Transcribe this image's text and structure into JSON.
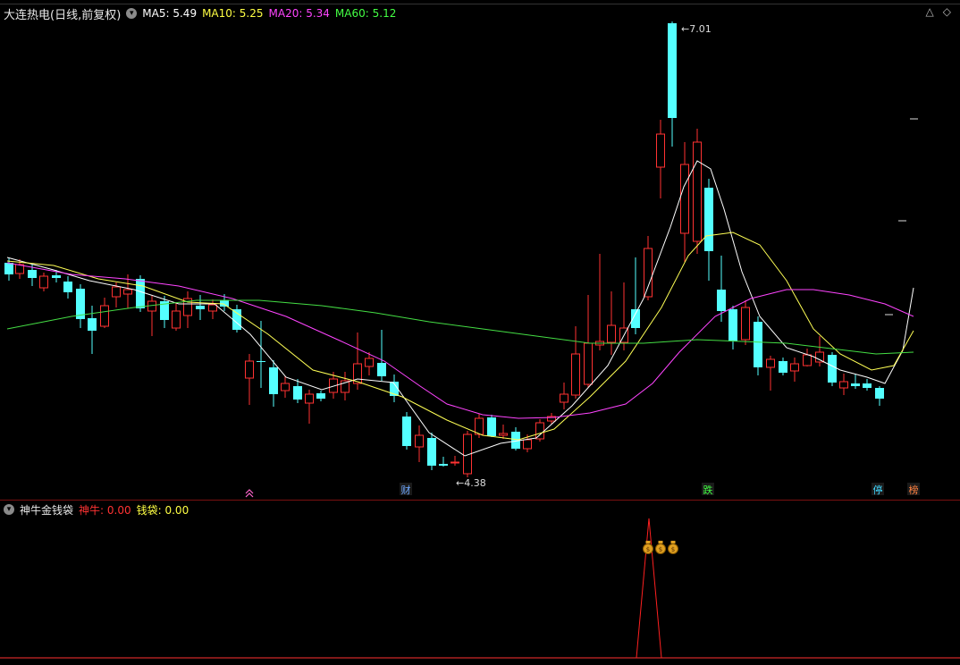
{
  "main": {
    "title": "大连热电(日线,前复权)",
    "ma": [
      {
        "label": "MA5:",
        "value": "5.49",
        "color": "#ffffff"
      },
      {
        "label": "MA10:",
        "value": "5.25",
        "color": "#ffff44"
      },
      {
        "label": "MA20:",
        "value": "5.34",
        "color": "#ff44ff"
      },
      {
        "label": "MA60:",
        "value": "5.12",
        "color": "#44ff44"
      }
    ],
    "high_label": "7.01",
    "low_label": "4.38",
    "markers": [
      {
        "text": "财",
        "color": "#6fa8ff"
      },
      {
        "text": "跌",
        "color": "#40ff40"
      },
      {
        "text": "停",
        "color": "#40d8ff"
      },
      {
        "text": "榜",
        "color": "#ff8040"
      }
    ],
    "icons": [
      "triangle-up-icon",
      "diamond-icon"
    ]
  },
  "sub": {
    "title": "神牛金钱袋",
    "shen_niu_label": "神牛:",
    "shen_niu_value": "0.00",
    "qian_dai_label": "钱袋:",
    "qian_dai_value": "0.00",
    "bag_icon": "money-bag-icon"
  },
  "colors": {
    "up": "#ff3232",
    "down": "#54ffff",
    "ma5": "#ffffff",
    "ma10": "#ffff55",
    "ma20": "#ff44ff",
    "ma60": "#44dd44",
    "grid": "#7a1010"
  }
}
